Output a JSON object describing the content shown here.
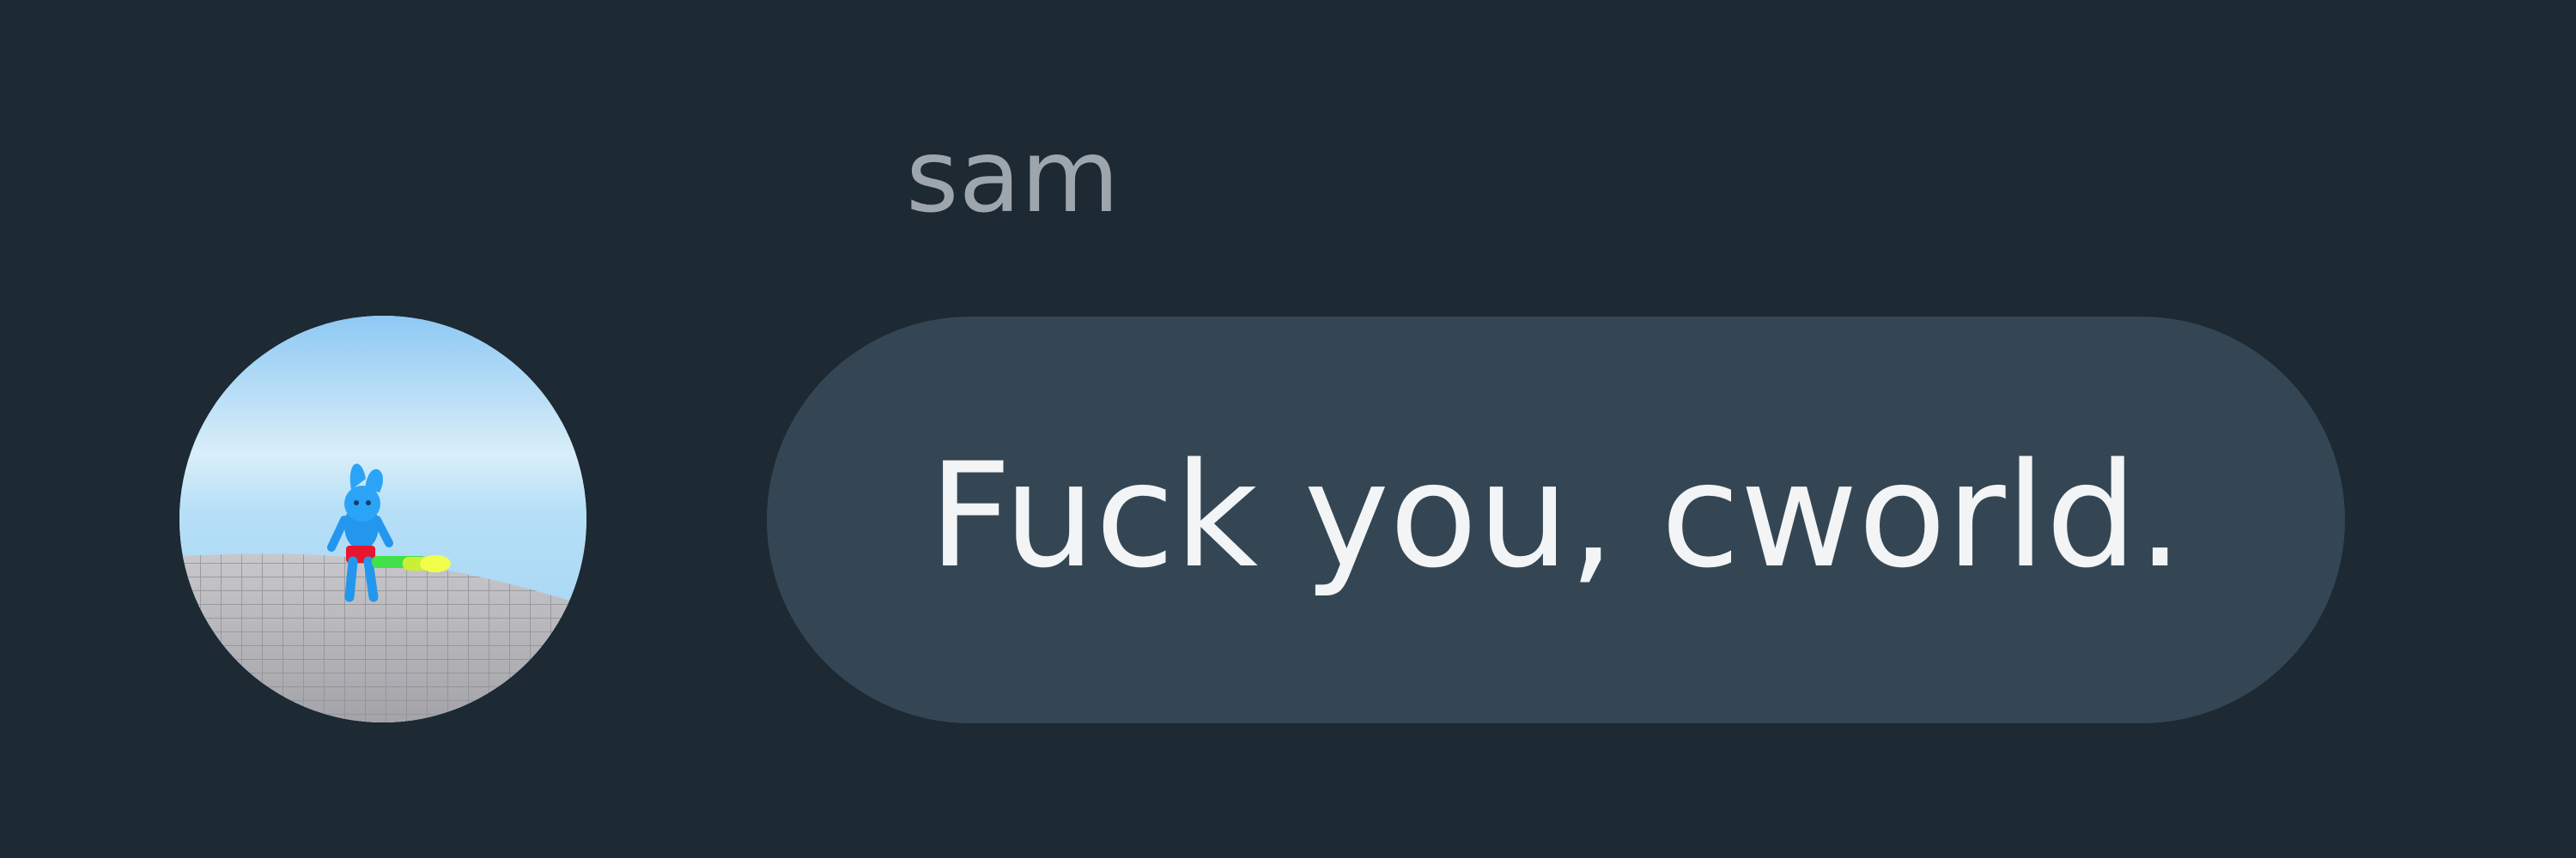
{
  "message": {
    "sender": "sam",
    "text": "Fuck you, cworld.",
    "avatar_icon": "user-avatar-figure"
  },
  "colors": {
    "background": "#1d2933",
    "bubble": "#344653",
    "sender_name": "#9ea6ad",
    "message_text": "#f2f4f5"
  }
}
